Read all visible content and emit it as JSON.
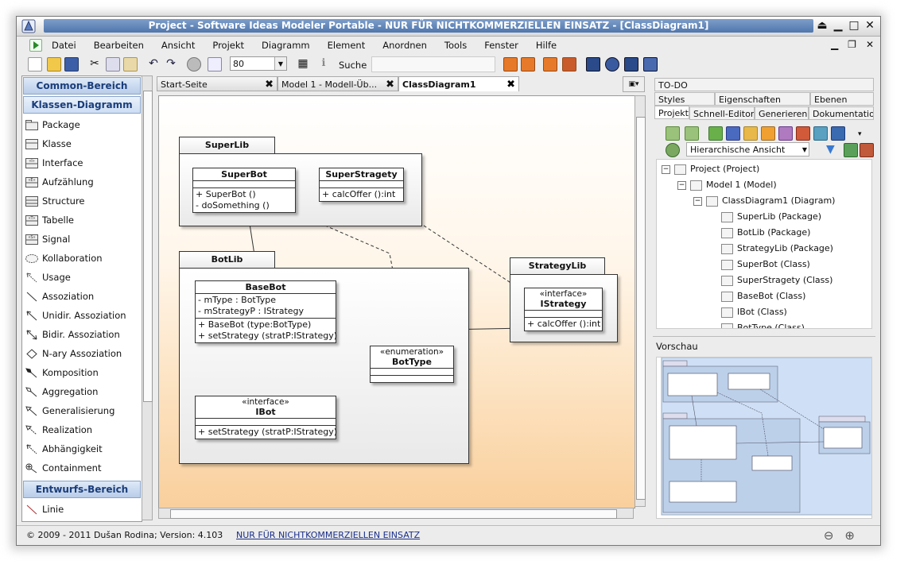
{
  "window": {
    "title": "Project - Software Ideas Modeler Portable - NUR FÜR NICHTKOMMERZIELLEN EINSATZ - [ClassDiagram1]"
  },
  "menu": [
    "Datei",
    "Bearbeiten",
    "Ansicht",
    "Projekt",
    "Diagramm",
    "Element",
    "Anordnen",
    "Tools",
    "Fenster",
    "Hilfe"
  ],
  "toolbar": {
    "zoom_value": "80",
    "search_label": "Suche",
    "search_value": ""
  },
  "palette": {
    "common_header": "Common-Bereich",
    "class_header": "Klassen-Diagramm",
    "items": [
      "Package",
      "Klasse",
      "Interface",
      "Aufzählung",
      "Structure",
      "Tabelle",
      "Signal",
      "Kollaboration",
      "Usage",
      "Assoziation",
      "Unidir. Assoziation",
      "Bidir. Assoziation",
      "N-ary Assoziation",
      "Komposition",
      "Aggregation",
      "Generalisierung",
      "Realization",
      "Abhängigkeit",
      "Containment"
    ],
    "design_header": "Entwurfs-Bereich",
    "design_items": [
      "Linie"
    ]
  },
  "doc_tabs": [
    {
      "label": "Start-Seite",
      "active": false
    },
    {
      "label": "Model 1 - Modell-Üb...",
      "active": false
    },
    {
      "label": "ClassDiagram1",
      "active": true
    }
  ],
  "diagram": {
    "packages": [
      {
        "name": "SuperLib"
      },
      {
        "name": "BotLib"
      },
      {
        "name": "StrategyLib"
      }
    ],
    "classes": {
      "superbot": {
        "name": "SuperBot",
        "methods": [
          "+ SuperBot ()",
          "- doSomething ()"
        ]
      },
      "superstragety": {
        "name": "SuperStragety",
        "methods": [
          "+ calcOffer ():int"
        ]
      },
      "basebot": {
        "name": "BaseBot",
        "attributes": [
          "- mType : BotType",
          "- mStrategyP : IStrategy"
        ],
        "methods": [
          "+ BaseBot (type:BotType)",
          "+ setStrategy (stratP:IStrategy)"
        ]
      },
      "botype": {
        "stereotype": "«enumeration»",
        "name": "BotType"
      },
      "ibot": {
        "stereotype": "«interface»",
        "name": "IBot",
        "methods": [
          "+ setStrategy (stratP:IStrategy)"
        ]
      },
      "istrategy": {
        "stereotype": "«interface»",
        "name": "IStrategy",
        "methods": [
          "+ calcOffer ():int"
        ]
      }
    }
  },
  "right_panel": {
    "tabs_row1": [
      "TO-DO"
    ],
    "tabs_row2": [
      "Styles",
      "Eigenschaften",
      "Ebenen"
    ],
    "tabs_row3": [
      "Projekt",
      "Schnell-Editor",
      "Generieren",
      "Dokumentatio"
    ],
    "view_select": "Hierarchische Ansicht",
    "tree": [
      {
        "label": "Project (Project)",
        "depth": 0,
        "expander": "−"
      },
      {
        "label": "Model 1 (Model)",
        "depth": 1,
        "expander": "−"
      },
      {
        "label": "ClassDiagram1 (Diagram)",
        "depth": 2,
        "expander": "−"
      },
      {
        "label": "SuperLib (Package)",
        "depth": 3,
        "expander": ""
      },
      {
        "label": "BotLib (Package)",
        "depth": 3,
        "expander": ""
      },
      {
        "label": "StrategyLib (Package)",
        "depth": 3,
        "expander": ""
      },
      {
        "label": "SuperBot (Class)",
        "depth": 3,
        "expander": ""
      },
      {
        "label": "SuperStragety (Class)",
        "depth": 3,
        "expander": ""
      },
      {
        "label": "BaseBot (Class)",
        "depth": 3,
        "expander": ""
      },
      {
        "label": "IBot (Class)",
        "depth": 3,
        "expander": ""
      },
      {
        "label": "BotType (Class)",
        "depth": 3,
        "expander": ""
      }
    ],
    "preview_header": "Vorschau"
  },
  "status": {
    "copyright": "© 2009 - 2011 Dušan Rodina; Version: 4.103",
    "license_link": "NUR FÜR NICHTKOMMERZIELLEN EINSATZ"
  },
  "colors": {
    "title_bar": "#5a7fb5",
    "palette_header": "#1a3d7a",
    "canvas_bottom": "#f9cf9c",
    "preview_bg": "#cfe0f6"
  }
}
